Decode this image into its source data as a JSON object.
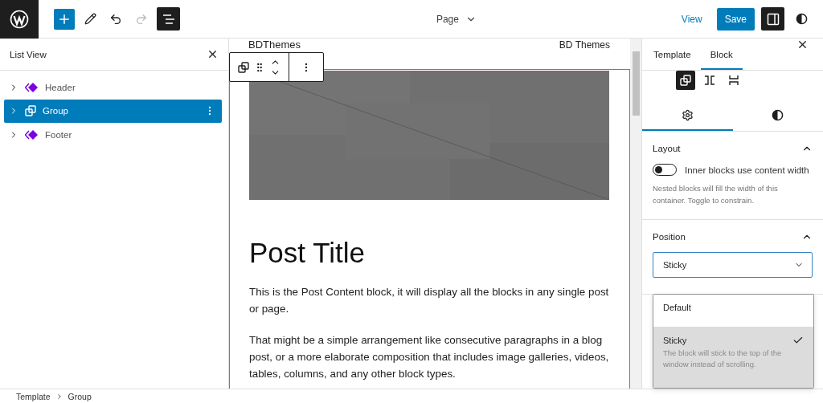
{
  "toolbar": {
    "page_label": "Page",
    "view": "View",
    "save": "Save",
    "list_view_active": true,
    "settings_active": true
  },
  "list_view": {
    "title": "List View",
    "items": [
      {
        "label": "Header",
        "kind": "template-part",
        "selected": false
      },
      {
        "label": "Group",
        "kind": "group",
        "selected": true
      },
      {
        "label": "Footer",
        "kind": "template-part",
        "selected": false
      }
    ]
  },
  "canvas": {
    "site_title": "BDThemes",
    "nav_item": "BD Themes",
    "post_title": "Post Title",
    "paragraphs": [
      "This is the Post Content block, it will display all the blocks in any single post or page.",
      "That might be a simple arrangement like consecutive paragraphs in a blog post, or a more elaborate composition that includes image galleries, videos, tables, columns, and any other block types."
    ]
  },
  "sidebar": {
    "tabs": [
      {
        "label": "Template",
        "selected": false
      },
      {
        "label": "Block",
        "selected": true
      }
    ],
    "variations": [
      {
        "kind": "group",
        "selected": true
      },
      {
        "kind": "row",
        "selected": false
      },
      {
        "kind": "stack",
        "selected": false
      }
    ],
    "panel_tabs": [
      {
        "kind": "settings",
        "selected": true
      },
      {
        "kind": "styles",
        "selected": false
      }
    ],
    "layout": {
      "title": "Layout",
      "expanded": true,
      "toggle_label": "Inner blocks use content width",
      "on": false,
      "help": "Nested blocks will fill the width of this container. Toggle to constrain."
    },
    "position": {
      "title": "Position",
      "expanded": true,
      "value": "Sticky",
      "options": [
        {
          "label": "Default",
          "selected": false
        },
        {
          "label": "Sticky",
          "selected": true,
          "description": "The block will stick to the top of the window instead of scrolling."
        }
      ]
    }
  },
  "breadcrumb": [
    "Template",
    "Group"
  ]
}
